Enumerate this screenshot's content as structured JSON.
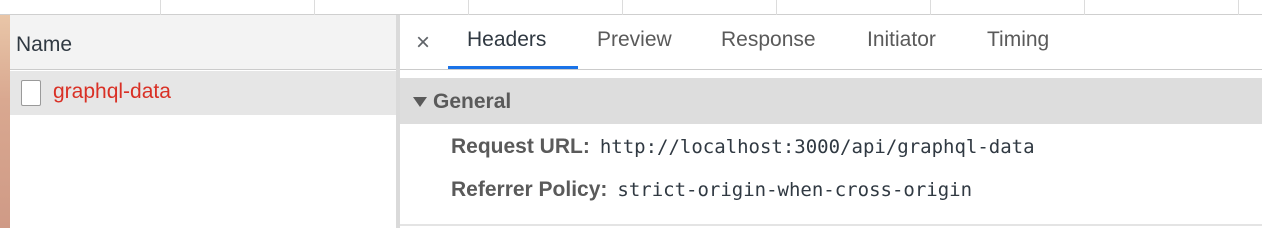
{
  "left_pane": {
    "column_header": "Name",
    "requests": [
      {
        "name": "graphql-data",
        "icon": "document-icon",
        "status_color": "#d93025"
      }
    ]
  },
  "detail": {
    "close_icon": "×",
    "tabs": [
      {
        "label": "Headers",
        "active": true
      },
      {
        "label": "Preview",
        "active": false
      },
      {
        "label": "Response",
        "active": false
      },
      {
        "label": "Initiator",
        "active": false
      },
      {
        "label": "Timing",
        "active": false
      }
    ],
    "general": {
      "title": "General",
      "request_url_label": "Request URL:",
      "request_url_value": "http://localhost:3000/api/graphql-data",
      "referrer_policy_label": "Referrer Policy:",
      "referrer_policy_value": "strict-origin-when-cross-origin"
    }
  },
  "colors": {
    "accent": "#1a73e8",
    "error_text": "#d93025"
  }
}
